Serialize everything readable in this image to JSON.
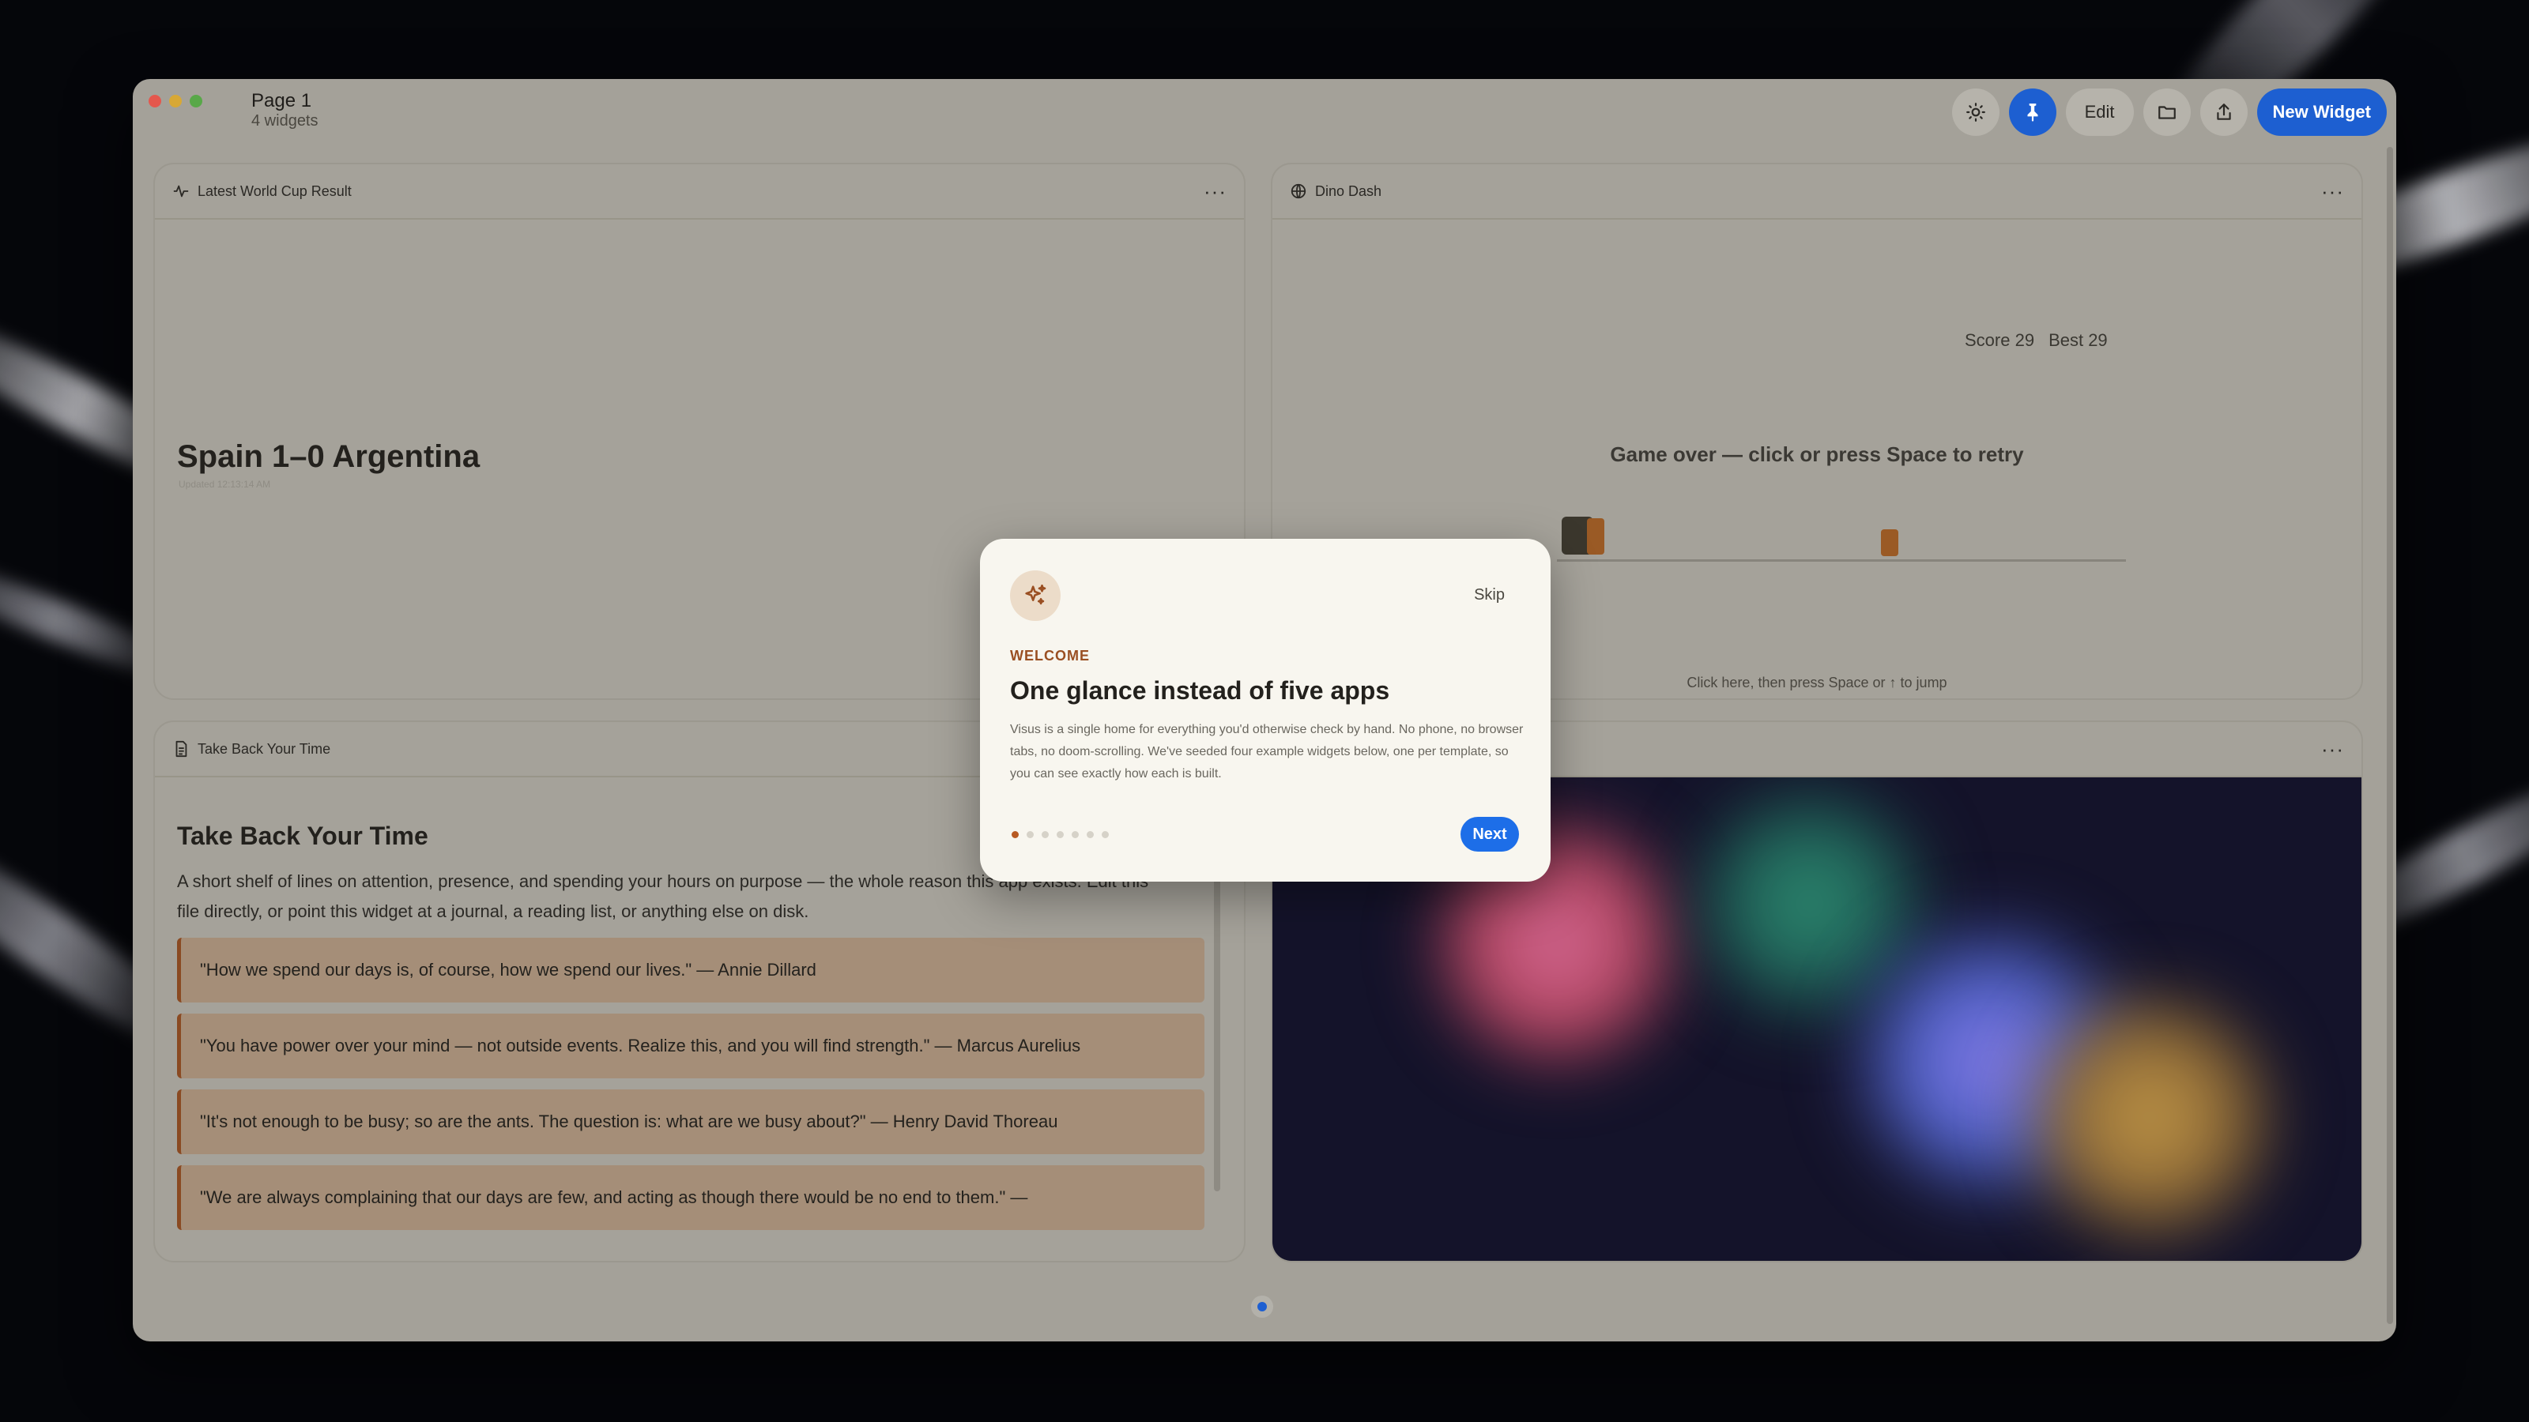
{
  "window": {
    "page_title": "Page 1",
    "page_subtitle": "4 widgets"
  },
  "toolbar": {
    "edit_label": "Edit",
    "new_widget_label": "New Widget"
  },
  "widgets": {
    "world_cup": {
      "title": "Latest World Cup Result",
      "score": "Spain 1–0 Argentina",
      "updated": "Updated 12:13:14 AM"
    },
    "dino": {
      "title": "Dino Dash",
      "score_label": "Score 29",
      "best_label": "Best 29",
      "status": "Game over — click or press Space to retry",
      "hint": "Click here, then press Space or ↑ to jump"
    },
    "reading": {
      "title": "Take Back Your Time",
      "heading": "Take Back Your Time",
      "intro": "A short shelf of lines on attention, presence, and spending your hours on purpose — the whole reason this app exists. Edit this file directly, or point this widget at a journal, a reading list, or anything else on disk.",
      "quotes": [
        "\"How we spend our days is, of course, how we spend our lives.\" — Annie Dillard",
        "\"You have power over your mind — not outside events. Realize this, and you will find strength.\" — Marcus Aurelius",
        "\"It's not enough to be busy; so are the ants. The question is: what are we busy about?\" — Henry David Thoreau",
        "\"We are always complaining that our days are few, and acting as though there would be no end to them.\" —"
      ]
    }
  },
  "modal": {
    "skip_label": "Skip",
    "eyebrow": "WELCOME",
    "title": "One glance instead of five apps",
    "description": "Visus is a single home for everything you'd otherwise check by hand. No phone, no browser tabs, no doom-scrolling. We've seeded four example widgets below, one per template, so you can see exactly how each is built.",
    "next_label": "Next",
    "steps_total": 7,
    "current_step": 1
  },
  "colors": {
    "accent": "#1d5fd1",
    "eyebrow": "#9a4f22",
    "quote_border": "#8a4a22"
  },
  "icons": [
    "sun-icon",
    "pin-icon",
    "folder-icon",
    "share-icon",
    "activity-icon",
    "globe-icon",
    "document-icon",
    "sparkles-icon",
    "more-icon"
  ]
}
